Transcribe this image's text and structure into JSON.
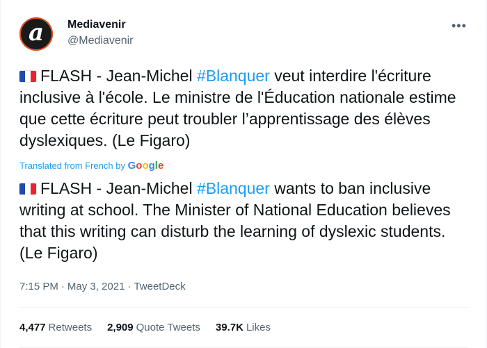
{
  "author": {
    "display_name": "Mediavenir",
    "handle": "@Mediavenir",
    "avatar_letter": "a"
  },
  "tweet": {
    "original": {
      "prefix": "FLASH - Jean-Michel ",
      "hashtag": "#Blanquer",
      "suffix": " veut interdire l'écriture inclusive à l'école. Le ministre de l'Éducation nationale estime que cette écriture peut troubler l’apprentissage des élèves dyslexiques. (Le Figaro)"
    },
    "translation_label": "Translated from French by",
    "translation_provider": [
      "G",
      "o",
      "o",
      "g",
      "l",
      "e"
    ],
    "translated": {
      "prefix": "FLASH - Jean-Michel ",
      "hashtag": "#Blanquer",
      "suffix": " wants to ban inclusive writing at school. The Minister of National Education believes that this writing can disturb the learning of dyslexic students. (Le Figaro)"
    },
    "time": "7:15 PM",
    "date": "May 3, 2021",
    "source": "TweetDeck"
  },
  "stats": {
    "retweets_count": "4,477",
    "retweets_label": "Retweets",
    "quote_count": "2,909",
    "quote_label": "Quote Tweets",
    "likes_count": "39.7K",
    "likes_label": "Likes"
  },
  "colors": {
    "accent": "#1d9bf0",
    "muted": "#536471",
    "text": "#0f1419"
  }
}
